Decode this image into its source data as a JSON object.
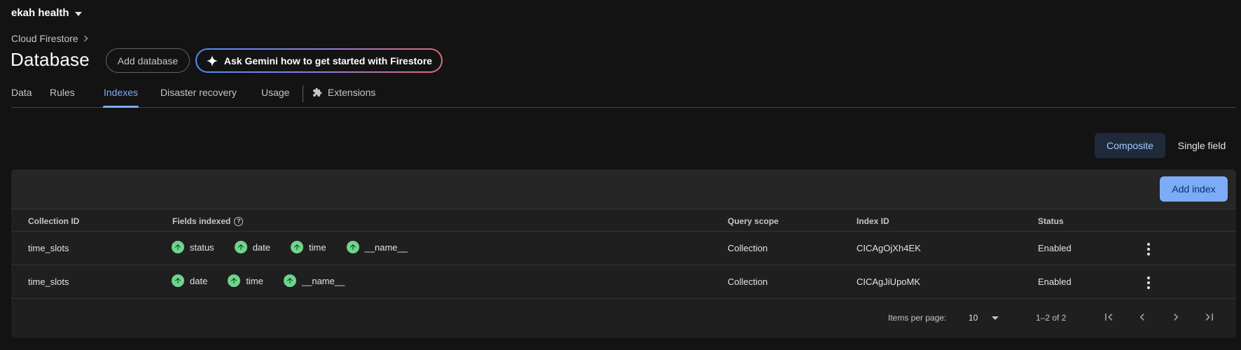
{
  "project": {
    "name": "ekah health"
  },
  "breadcrumb": {
    "label": "Cloud Firestore"
  },
  "header": {
    "title": "Database",
    "add_database_label": "Add database",
    "gemini_label": "Ask Gemini how to get started with Firestore"
  },
  "tabs": [
    {
      "label": "Data"
    },
    {
      "label": "Rules"
    },
    {
      "label": "Indexes",
      "active": true
    },
    {
      "label": "Disaster recovery"
    },
    {
      "label": "Usage"
    },
    {
      "label": "Extensions"
    }
  ],
  "index_type_toggle": {
    "composite_label": "Composite",
    "single_label": "Single field",
    "selected": "Composite"
  },
  "table": {
    "add_index_label": "Add index",
    "columns": {
      "collection_id": "Collection ID",
      "fields_indexed": "Fields indexed",
      "query_scope": "Query scope",
      "index_id": "Index ID",
      "status": "Status"
    },
    "rows": [
      {
        "collection_id": "time_slots",
        "fields": [
          "status",
          "date",
          "time",
          "__name__"
        ],
        "query_scope": "Collection",
        "index_id": "CICAgOjXh4EK",
        "status": "Enabled"
      },
      {
        "collection_id": "time_slots",
        "fields": [
          "date",
          "time",
          "__name__"
        ],
        "query_scope": "Collection",
        "index_id": "CICAgJiUpoMK",
        "status": "Enabled"
      }
    ]
  },
  "pagination": {
    "items_per_page_label": "Items per page:",
    "items_per_page": "10",
    "range": "1–2 of 2"
  },
  "colors": {
    "accent": "#7cacf8",
    "ascending_badge": "#6dd58c",
    "background": "#131314"
  },
  "icons": [
    "chevron-down-icon",
    "chevron-right-icon",
    "sparkle-icon",
    "extensions-icon",
    "help-icon",
    "arrow-up-icon",
    "more-vert-icon",
    "first-page-icon",
    "prev-page-icon",
    "next-page-icon",
    "last-page-icon"
  ]
}
